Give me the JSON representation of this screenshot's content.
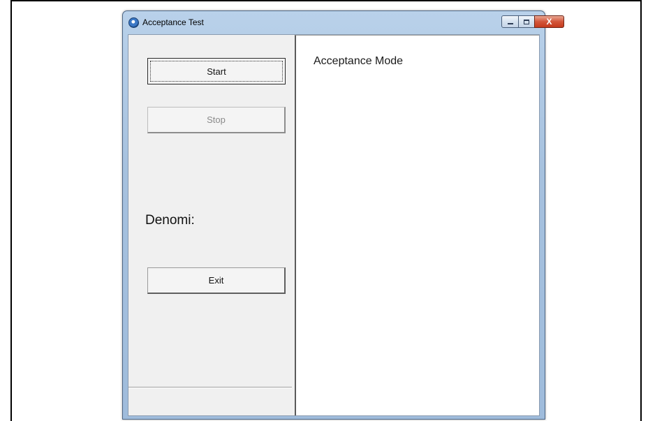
{
  "window": {
    "title": "Acceptance Test",
    "controls": {
      "minimize": "",
      "maximize": "",
      "close": "X"
    }
  },
  "left_panel": {
    "start_label": "Start",
    "stop_label": "Stop",
    "denomi_label": "Denomi:",
    "exit_label": "Exit"
  },
  "right_panel": {
    "mode_text": "Acceptance Mode"
  }
}
